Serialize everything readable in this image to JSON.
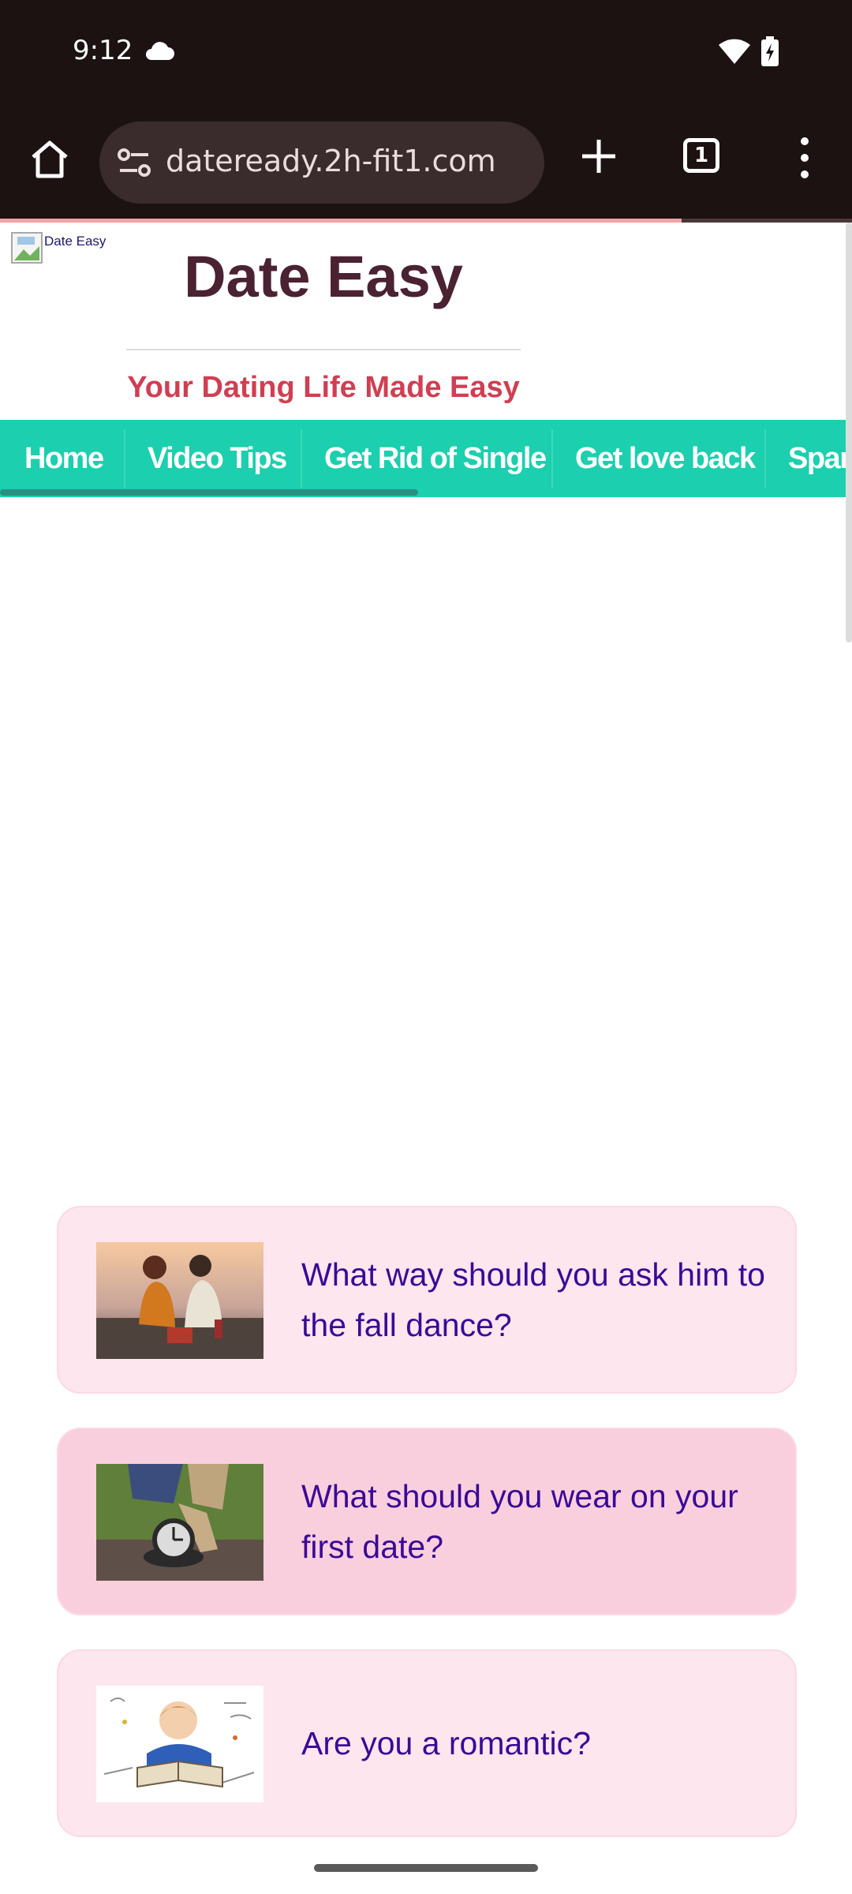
{
  "status_bar": {
    "time": "9:12",
    "icons": [
      "cloud-icon",
      "wifi-icon",
      "battery-charging-icon"
    ]
  },
  "browser": {
    "url": "dateready.2h-fit1.com",
    "tab_count": "1",
    "load_progress_percent": 80,
    "icons": [
      "home-icon",
      "site-info-icon",
      "plus-icon",
      "tab-switcher-icon",
      "more-vert-icon"
    ]
  },
  "header": {
    "logo_alt": "Date Easy",
    "title": "Date Easy",
    "tagline": "Your Dating Life Made Easy"
  },
  "nav": {
    "items": [
      "Home",
      "Video Tips",
      "Get Rid of Single",
      "Get love back",
      "Spark"
    ]
  },
  "articles": [
    {
      "title": "What way should you ask him to the fall dance?",
      "thumb": "couple-picnic-thumbnail"
    },
    {
      "title": "What should you wear on your first date?",
      "thumb": "clock-on-ground-thumbnail"
    },
    {
      "title": "Are you a romantic?",
      "thumb": "boy-reading-book-thumbnail"
    }
  ],
  "colors": {
    "chrome_bg": "#1c1212",
    "title": "#4a2232",
    "tagline": "#cf3f52",
    "nav_bg": "#1ccfae",
    "card_light": "#fde6ee",
    "card_dark": "#f9cfde",
    "link": "#3b0996"
  }
}
